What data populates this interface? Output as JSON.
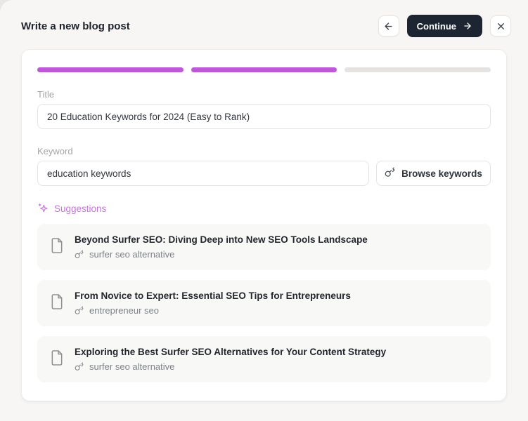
{
  "header": {
    "title": "Write a new blog post",
    "continue_label": "Continue"
  },
  "progress": {
    "total_steps": 3,
    "completed_steps": 2
  },
  "form": {
    "title_label": "Title",
    "title_value": "20 Education Keywords for 2024 (Easy to Rank)",
    "keyword_label": "Keyword",
    "keyword_value": "education keywords",
    "browse_button_label": "Browse keywords"
  },
  "suggestions": {
    "heading": "Suggestions",
    "items": [
      {
        "title": "Beyond Surfer SEO: Diving Deep into New SEO Tools Landscape",
        "keyword": "surfer seo alternative"
      },
      {
        "title": "From Novice to Expert: Essential SEO Tips for Entrepreneurs",
        "keyword": "entrepreneur seo"
      },
      {
        "title": "Exploring the Best Surfer SEO Alternatives for Your Content Strategy",
        "keyword": "surfer seo alternative"
      }
    ]
  },
  "icons": {
    "back": "arrow-left",
    "continue": "arrow-right",
    "close": "x",
    "keyword": "key",
    "suggestions": "sparkles",
    "post": "file"
  },
  "colors": {
    "accent_purple": "#bd59d6",
    "suggestions_purple": "#c873de",
    "progress_track": "#e4e3e2",
    "continue_button_bg": "#1e2532",
    "page_background": "#f7f6f4",
    "card_background": "#ffffff",
    "suggestion_background": "#f8f8f7"
  }
}
